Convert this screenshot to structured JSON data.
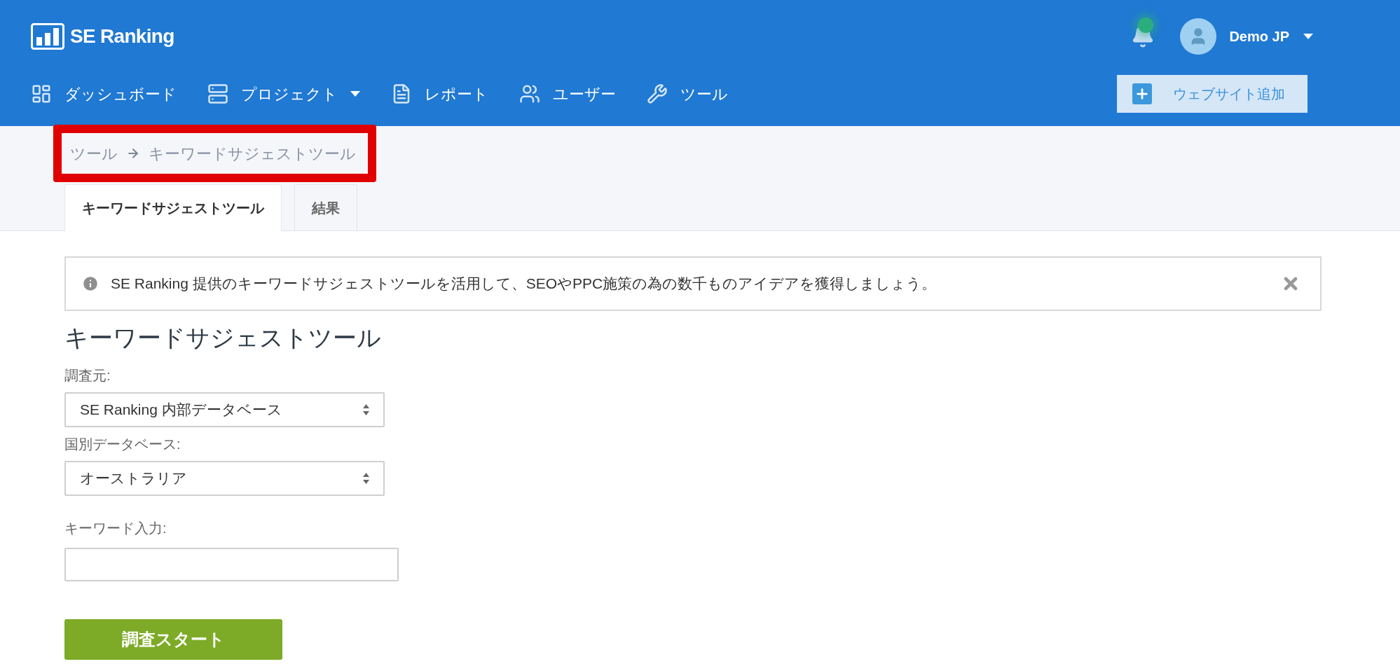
{
  "header": {
    "logo": "SE Ranking",
    "notification": {
      "unread": true
    },
    "user": {
      "name": "Demo JP"
    },
    "nav": [
      {
        "label": "ダッシュボード",
        "has_menu": false
      },
      {
        "label": "プロジェクト",
        "has_menu": true
      },
      {
        "label": "レポート",
        "has_menu": false
      },
      {
        "label": "ユーザー",
        "has_menu": false
      },
      {
        "label": "ツール",
        "has_menu": false
      }
    ],
    "add_button": "ウェブサイト追加"
  },
  "breadcrumb": {
    "highlighted": true,
    "items": [
      "ツール",
      "キーワードサジェストツール"
    ]
  },
  "tabs": [
    {
      "label": "キーワードサジェストツール",
      "selected": true
    },
    {
      "label": "結果",
      "selected": false
    }
  ],
  "alert": {
    "text": "SE Ranking 提供のキーワードサジェストツールを活用して、SEOやPPC施策の為の数千ものアイデアを獲得しましょう。",
    "closable": true
  },
  "form": {
    "title": "キーワードサジェストツール",
    "fields": [
      {
        "kind": "select",
        "label": "調査元:",
        "value": "SE Ranking 内部データベース"
      },
      {
        "kind": "select",
        "label": "国別データベース:",
        "value": "オーストラリア"
      },
      {
        "kind": "text",
        "label": "キーワード入力:"
      }
    ],
    "submit": "調査スタート"
  }
}
